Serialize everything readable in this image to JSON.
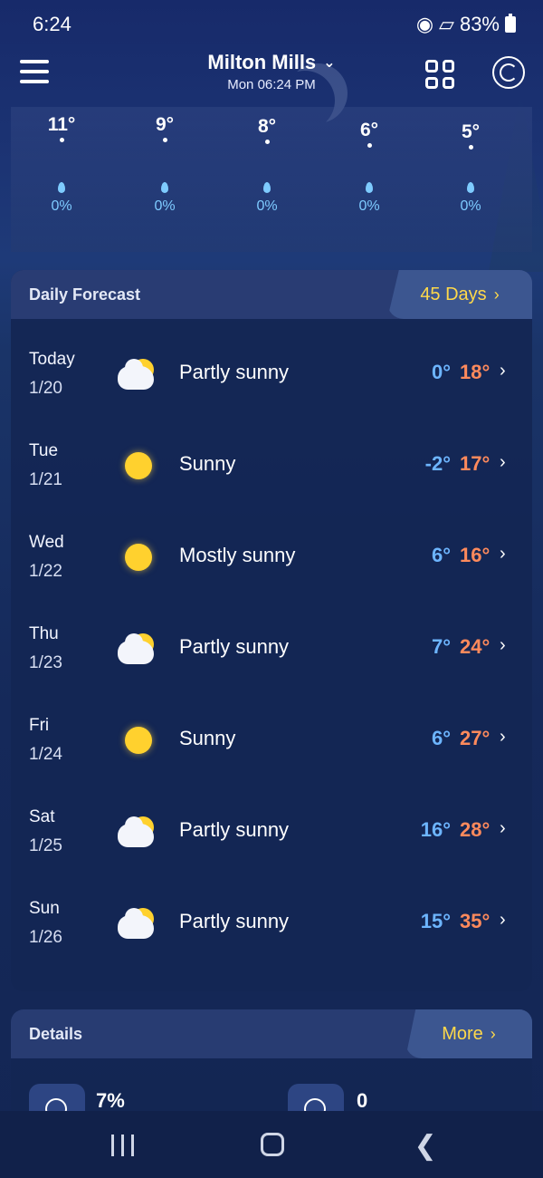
{
  "status_bar": {
    "time": "6:24",
    "battery": "83%"
  },
  "header": {
    "location": "Milton Mills",
    "local_time": "Mon 06:24 PM"
  },
  "hourly": [
    {
      "temp": "11°",
      "precip": "0%"
    },
    {
      "temp": "9°",
      "precip": "0%"
    },
    {
      "temp": "8°",
      "precip": "0%"
    },
    {
      "temp": "6°",
      "precip": "0%"
    },
    {
      "temp": "5°",
      "precip": "0%"
    }
  ],
  "daily_forecast": {
    "title": "Daily Forecast",
    "more_label": "45 Days",
    "days": [
      {
        "day": "Today",
        "date": "1/20",
        "icon": "partly-sunny-icon",
        "condition": "Partly sunny",
        "low": "0°",
        "high": "18°"
      },
      {
        "day": "Tue",
        "date": "1/21",
        "icon": "sun-icon",
        "condition": "Sunny",
        "low": "-2°",
        "high": "17°"
      },
      {
        "day": "Wed",
        "date": "1/22",
        "icon": "sun-icon",
        "condition": "Mostly sunny",
        "low": "6°",
        "high": "16°"
      },
      {
        "day": "Thu",
        "date": "1/23",
        "icon": "partly-sunny-icon",
        "condition": "Partly sunny",
        "low": "7°",
        "high": "24°"
      },
      {
        "day": "Fri",
        "date": "1/24",
        "icon": "sun-icon",
        "condition": "Sunny",
        "low": "6°",
        "high": "27°"
      },
      {
        "day": "Sat",
        "date": "1/25",
        "icon": "partly-sunny-icon",
        "condition": "Partly sunny",
        "low": "16°",
        "high": "28°"
      },
      {
        "day": "Sun",
        "date": "1/26",
        "icon": "partly-sunny-icon",
        "condition": "Partly sunny",
        "low": "15°",
        "high": "35°"
      }
    ]
  },
  "details": {
    "title": "Details",
    "more_label": "More",
    "items": [
      {
        "icon": "humidity-icon",
        "value": "7%"
      },
      {
        "icon": "uv-index-icon",
        "value": "0"
      }
    ]
  },
  "colors": {
    "accent_yellow": "#ffd94a",
    "low_temp": "#6db5ff",
    "high_temp": "#ff8a5c",
    "precip": "#7ecbff"
  }
}
